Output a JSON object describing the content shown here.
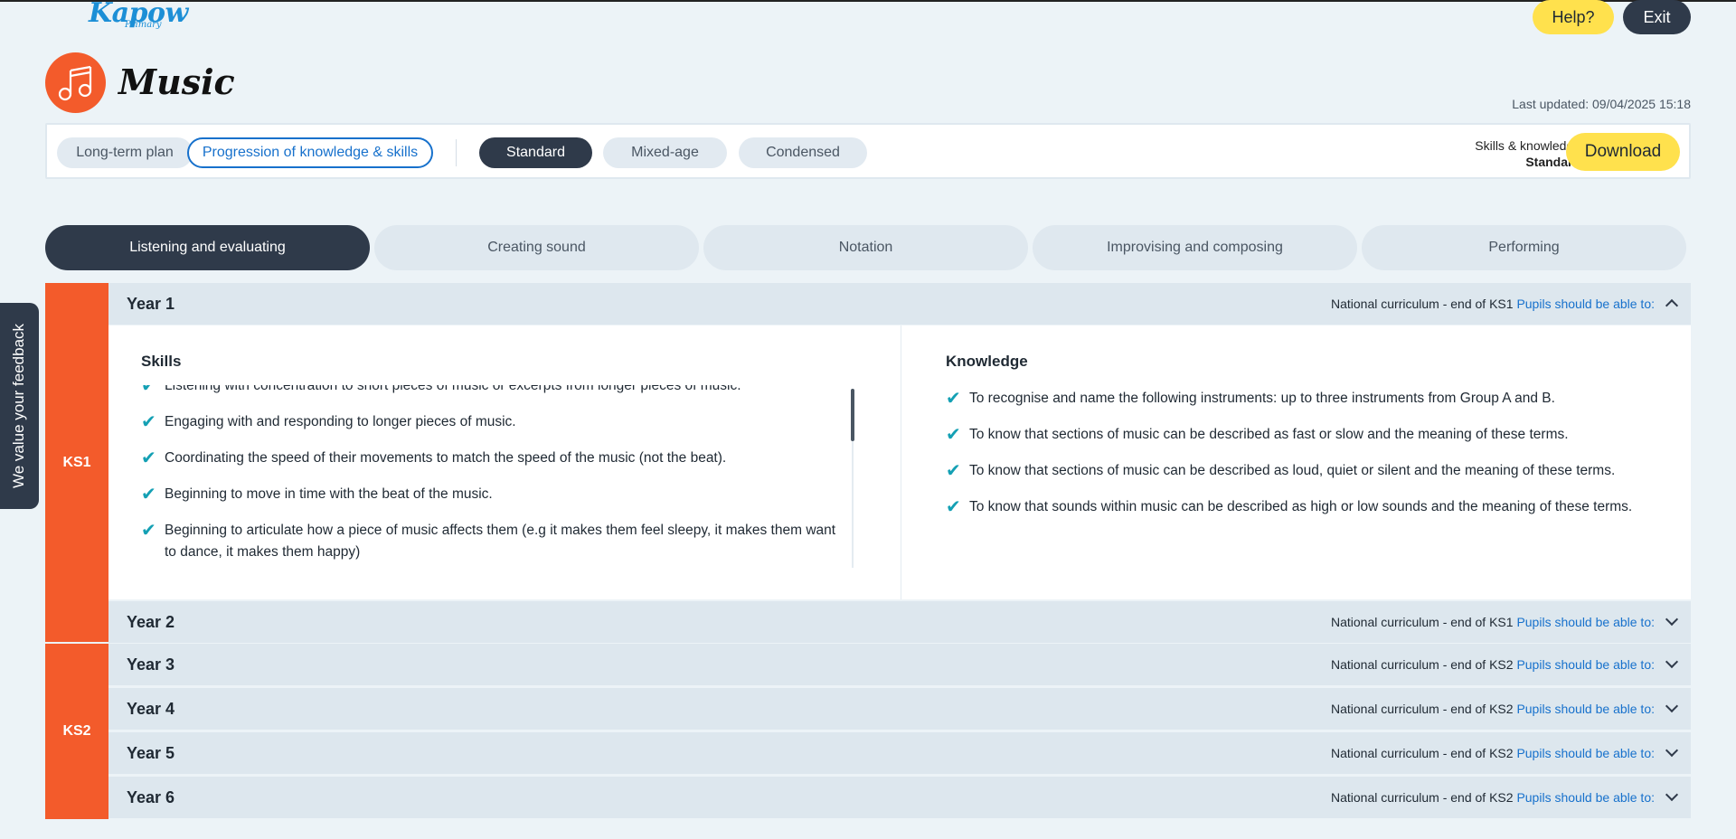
{
  "app": {
    "logo_main": "Kapow",
    "logo_sub": "Primary",
    "help_label": "Help?",
    "exit_label": "Exit"
  },
  "subject": {
    "title": "Music",
    "last_updated": "Last updated: 09/04/2025 15:18"
  },
  "toolbar": {
    "long_term_plan": "Long-term plan",
    "progression": "Progression of knowledge & skills",
    "standard": "Standard",
    "mixed_age": "Mixed-age",
    "condensed": "Condensed",
    "sk_label": "Skills & knowledge",
    "sk_value": "Standard",
    "download": "Download"
  },
  "strands": [
    {
      "label": "Listening and evaluating",
      "active": true
    },
    {
      "label": "Creating sound",
      "active": false
    },
    {
      "label": "Notation",
      "active": false
    },
    {
      "label": "Improvising and composing",
      "active": false
    },
    {
      "label": "Performing",
      "active": false
    }
  ],
  "feedback_label": "We value your feedback",
  "key_stages": {
    "ks1": "KS1",
    "ks2": "KS2"
  },
  "years": [
    {
      "label": "Year 1",
      "nc": "National curriculum - end of KS1",
      "link": "Pupils should be able to:",
      "expanded": true
    },
    {
      "label": "Year 2",
      "nc": "National curriculum - end of KS1",
      "link": "Pupils should be able to:",
      "expanded": false
    },
    {
      "label": "Year 3",
      "nc": "National curriculum - end of KS2",
      "link": "Pupils should be able to:",
      "expanded": false
    },
    {
      "label": "Year 4",
      "nc": "National curriculum - end of KS2",
      "link": "Pupils should be able to:",
      "expanded": false
    },
    {
      "label": "Year 5",
      "nc": "National curriculum - end of KS2",
      "link": "Pupils should be able to:",
      "expanded": false
    },
    {
      "label": "Year 6",
      "nc": "National curriculum - end of KS2",
      "link": "Pupils should be able to:",
      "expanded": false
    }
  ],
  "panel": {
    "skills_title": "Skills",
    "knowledge_title": "Knowledge",
    "skills": [
      "Listening with concentration to short pieces of music or excerpts from longer pieces of music.",
      "Engaging with and responding to longer pieces of music.",
      "Coordinating the speed of their movements to match the speed of the music (not the beat).",
      "Beginning to move in time with the beat of the music.",
      "Beginning to articulate how a piece of music affects them (e.g it makes them feel sleepy, it makes them want to dance, it makes them happy)"
    ],
    "knowledge": [
      "To recognise and name the following instruments: up to three instruments from Group A and B.",
      "To know that sections of music can be described as fast or slow and the meaning of these terms.",
      "To know that sections of music can be described as loud, quiet or silent and the meaning of these terms.",
      "To know that sounds within music can be described as high or low sounds and the meaning of these terms."
    ]
  },
  "colors": {
    "accent_orange": "#f35b2b",
    "dark": "#2f3a4a",
    "yellow": "#ffe14d",
    "link_blue": "#1771cc",
    "tick_teal": "#14a0b4"
  },
  "icons": {
    "subject": "music-note-icon",
    "tick": "check-icon",
    "chevron": "chevron-icon"
  }
}
